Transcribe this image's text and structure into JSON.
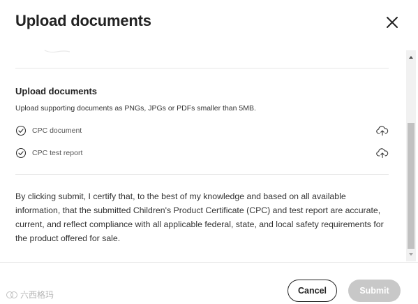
{
  "modal": {
    "title": "Upload documents",
    "close_icon": "close-icon"
  },
  "upload_section": {
    "title": "Upload documents",
    "description": "Upload supporting documents as PNGs, JPGs or PDFs smaller than 5MB.",
    "documents": [
      {
        "label": "CPC document",
        "status_icon": "check-circle-icon",
        "action_icon": "cloud-upload-icon"
      },
      {
        "label": "CPC test report",
        "status_icon": "check-circle-icon",
        "action_icon": "cloud-upload-icon"
      }
    ]
  },
  "certification_text": "By clicking submit, I certify that, to the best of my knowledge and based on all available information, that the submitted Children's Product Certificate (CPC) and test report are accurate, current, and reflect compliance with all applicable federal, state, and local safety requirements for the product offered for sale.",
  "footer": {
    "cancel_label": "Cancel",
    "submit_label": "Submit",
    "submit_disabled": true
  },
  "watermark": {
    "text": "六西格玛"
  },
  "colors": {
    "text_primary": "#222222",
    "text_secondary": "#555555",
    "divider": "#e6e6e6",
    "submit_disabled_bg": "#c8c8c8"
  }
}
